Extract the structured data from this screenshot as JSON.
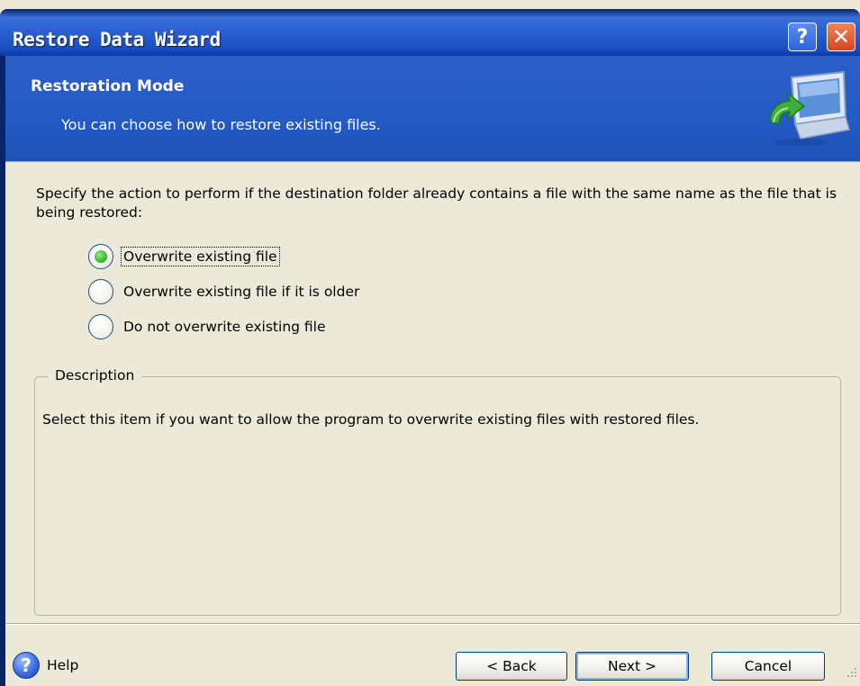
{
  "window": {
    "title": "Restore Data Wizard",
    "help_button": "?",
    "close_button": "✕"
  },
  "header": {
    "title": "Restoration Mode",
    "subtitle": "You can choose how to restore existing files.",
    "icon": "computer-restore-icon"
  },
  "main": {
    "instruction": "Specify the action to perform if the destination folder already contains a file with the same name as the file that is being restored:",
    "options": [
      {
        "label": "Overwrite existing file",
        "selected": true
      },
      {
        "label": "Overwrite existing file if it is older",
        "selected": false
      },
      {
        "label": "Do not overwrite existing file",
        "selected": false
      }
    ],
    "description": {
      "legend": "Description",
      "text": "Select this item if you want to allow the program to overwrite existing files with restored files."
    }
  },
  "footer": {
    "help_label": "Help",
    "back_label": "< Back",
    "next_label": "Next >",
    "cancel_label": "Cancel"
  },
  "colors": {
    "title_bar": "#2a5fd0",
    "header_band": "#245ac4",
    "dialog_face": "#ece9d8",
    "close_button": "#d6451e",
    "radio_selected": "#3fbf3a"
  }
}
